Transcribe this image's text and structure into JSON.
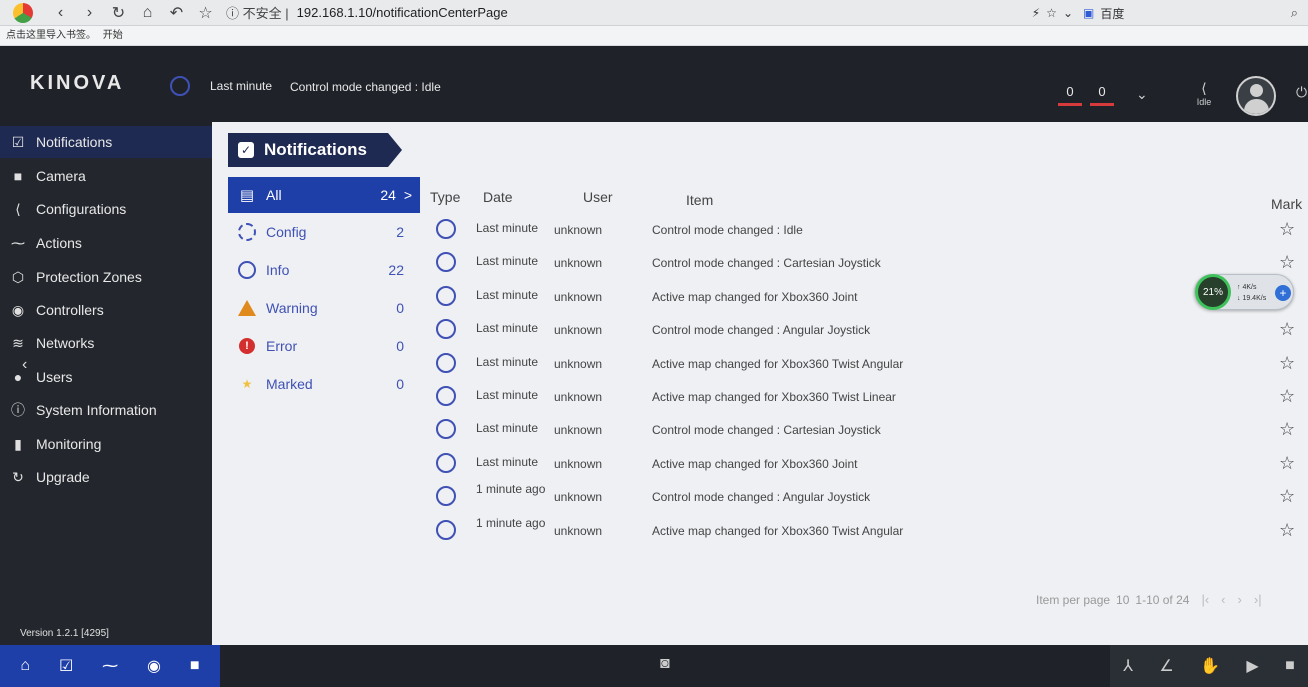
{
  "browser": {
    "security_label": "不安全",
    "url": "192.168.1.10/notificationCenterPage",
    "search_engine": "百度",
    "bookmark_hint": "点击这里导入书签。",
    "bookmark_start": "开始"
  },
  "header": {
    "brand": "KINOVA",
    "last_time": "Last minute",
    "last_message": "Control mode changed : Idle",
    "counter_a": "0",
    "counter_b": "0",
    "mode_label": "Idle"
  },
  "sidebar": {
    "items": [
      {
        "label": "Notifications",
        "icon": "check-square-icon"
      },
      {
        "label": "Camera",
        "icon": "camera-icon"
      },
      {
        "label": "Configurations",
        "icon": "arm-icon"
      },
      {
        "label": "Actions",
        "icon": "trend-icon"
      },
      {
        "label": "Protection Zones",
        "icon": "cube-icon"
      },
      {
        "label": "Controllers",
        "icon": "gamepad-icon"
      },
      {
        "label": "Networks",
        "icon": "wifi-icon"
      },
      {
        "label": "Users",
        "icon": "user-icon"
      },
      {
        "label": "System Information",
        "icon": "info-icon"
      },
      {
        "label": "Monitoring",
        "icon": "bar-chart-icon"
      },
      {
        "label": "Upgrade",
        "icon": "refresh-icon"
      }
    ],
    "version": "Version 1.2.1 [4295]"
  },
  "page": {
    "title": "Notifications"
  },
  "filters": [
    {
      "label": "All",
      "count": "24",
      "arrow": ">"
    },
    {
      "label": "Config",
      "count": "2"
    },
    {
      "label": "Info",
      "count": "22"
    },
    {
      "label": "Warning",
      "count": "0"
    },
    {
      "label": "Error",
      "count": "0"
    },
    {
      "label": "Marked",
      "count": "0"
    }
  ],
  "table": {
    "headers": {
      "type": "Type",
      "date": "Date",
      "user": "User",
      "item": "Item",
      "mark": "Mark"
    },
    "rows": [
      {
        "date": "Last minute",
        "user": "unknown",
        "item": "Control mode changed : Idle"
      },
      {
        "date": "Last minute",
        "user": "unknown",
        "item": "Control mode changed : Cartesian Joystick"
      },
      {
        "date": "Last minute",
        "user": "unknown",
        "item": "Active map changed for Xbox360 Joint"
      },
      {
        "date": "Last minute",
        "user": "unknown",
        "item": "Control mode changed : Angular Joystick"
      },
      {
        "date": "Last minute",
        "user": "unknown",
        "item": "Active map changed for Xbox360 Twist Angular"
      },
      {
        "date": "Last minute",
        "user": "unknown",
        "item": "Active map changed for Xbox360 Twist Linear"
      },
      {
        "date": "Last minute",
        "user": "unknown",
        "item": "Control mode changed : Cartesian Joystick"
      },
      {
        "date": "Last minute",
        "user": "unknown",
        "item": "Active map changed for Xbox360 Joint"
      },
      {
        "date": "1 minute ago",
        "user": "unknown",
        "item": "Control mode changed : Angular Joystick"
      },
      {
        "date": "1 minute ago",
        "user": "unknown",
        "item": "Active map changed for Xbox360 Twist Angular"
      }
    ]
  },
  "pagination": {
    "items_per_page_label": "Item per page",
    "items_per_page": "10",
    "range": "1-10 of 24"
  },
  "net_widget": {
    "percent": "21%",
    "up": "4K/s",
    "down": "19.4K/s"
  }
}
